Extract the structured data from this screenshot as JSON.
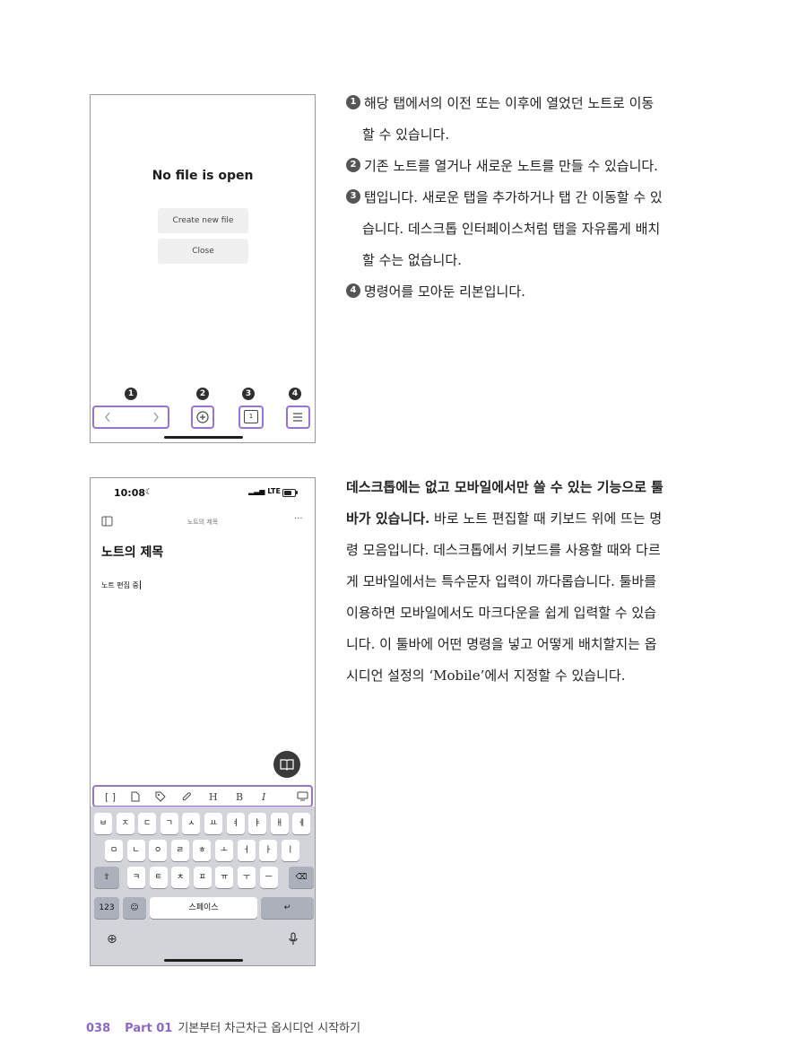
{
  "screen1": {
    "no_file_title": "No file is open",
    "create_button": "Create new file",
    "close_button": "Close",
    "markers": [
      "1",
      "2",
      "3",
      "4"
    ],
    "tab_count": "1"
  },
  "screen2": {
    "status_time": "10:08",
    "status_signal": "LTE",
    "header_title": "노트의 제목",
    "note_title": "노트의 제목",
    "note_body": "노트 편집 중",
    "toolbar_letters": [
      "H",
      "B",
      "I"
    ],
    "keyboard": {
      "row1": [
        "ㅂ",
        "ㅈ",
        "ㄷ",
        "ㄱ",
        "ㅅ",
        "ㅛ",
        "ㅕ",
        "ㅑ",
        "ㅐ",
        "ㅔ"
      ],
      "row2": [
        "ㅁ",
        "ㄴ",
        "ㅇ",
        "ㄹ",
        "ㅎ",
        "ㅗ",
        "ㅓ",
        "ㅏ",
        "ㅣ"
      ],
      "row3": [
        "ㅋ",
        "ㅌ",
        "ㅊ",
        "ㅍ",
        "ㅠ",
        "ㅜ",
        "ㅡ"
      ],
      "num_key": "123",
      "space_key": "스페이스"
    }
  },
  "list_items": [
    {
      "num": "1",
      "lines": [
        "해당 탭에서의 이전 또는 이후에 열었던 노트로 이동",
        "할 수 있습니다."
      ]
    },
    {
      "num": "2",
      "lines": [
        "기존 노트를 열거나 새로운 노트를 만들 수 있습니다."
      ]
    },
    {
      "num": "3",
      "lines": [
        "탭입니다. 새로운 탭을 추가하거나 탭 간 이동할 수 있",
        "습니다. 데스크톱 인터페이스처럼 탭을 자유롭게 배치",
        "할 수는 없습니다."
      ]
    },
    {
      "num": "4",
      "lines": [
        "명령어를 모아둔 리본입니다."
      ]
    }
  ],
  "paragraph": {
    "bold_line1": "데스크톱에는 없고 모바일에서만 쓸 수 있는 기능으로 툴",
    "bold_line2": "바가 있습니다.",
    "line2_rest": " 바로 노트 편집할 때 키보드 위에 뜨는 명",
    "lines": [
      "령 모음입니다. 데스크톱에서 키보드를 사용할 때와 다르",
      "게 모바일에서는 특수문자 입력이 까다롭습니다. 툴바를",
      "이용하면 모바일에서도 마크다운을 쉽게 입력할 수 있습",
      "니다. 이 툴바에 어떤 명령을 넣고 어떻게 배치할지는 옵",
      "시디언 설정의 ‘Mobile’에서 지정할 수 있습니다."
    ]
  },
  "footer": {
    "page": "038",
    "part": "Part 01",
    "title": "기본부터 차근차근 옵시디언 시작하기"
  },
  "colors": {
    "accent": "#9b72d3",
    "footer_accent": "#8a68c8"
  }
}
